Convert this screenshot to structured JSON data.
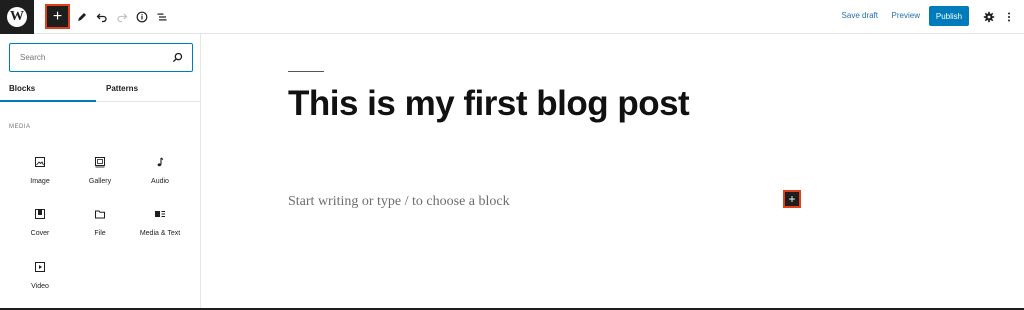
{
  "toolbar": {
    "logo_letter": "W",
    "inserter_glyph": "+",
    "save_draft": "Save draft",
    "preview": "Preview",
    "publish": "Publish"
  },
  "sidebar": {
    "search_placeholder": "Search",
    "tabs": [
      {
        "label": "Blocks",
        "active": true
      },
      {
        "label": "Patterns",
        "active": false
      }
    ],
    "section_label": "MEDIA",
    "blocks": [
      {
        "label": "Image",
        "icon": "image-icon"
      },
      {
        "label": "Gallery",
        "icon": "gallery-icon"
      },
      {
        "label": "Audio",
        "icon": "audio-icon"
      },
      {
        "label": "Cover",
        "icon": "cover-icon"
      },
      {
        "label": "File",
        "icon": "file-icon"
      },
      {
        "label": "Media & Text",
        "icon": "media-text-icon"
      },
      {
        "label": "Video",
        "icon": "video-icon"
      }
    ]
  },
  "editor": {
    "title": "This is my first blog post",
    "placeholder": "Start writing or type / to choose a block",
    "inline_inserter_glyph": "+"
  },
  "colors": {
    "accent": "#007cba",
    "highlight": "#e2401c",
    "dark": "#1e1e1e"
  }
}
